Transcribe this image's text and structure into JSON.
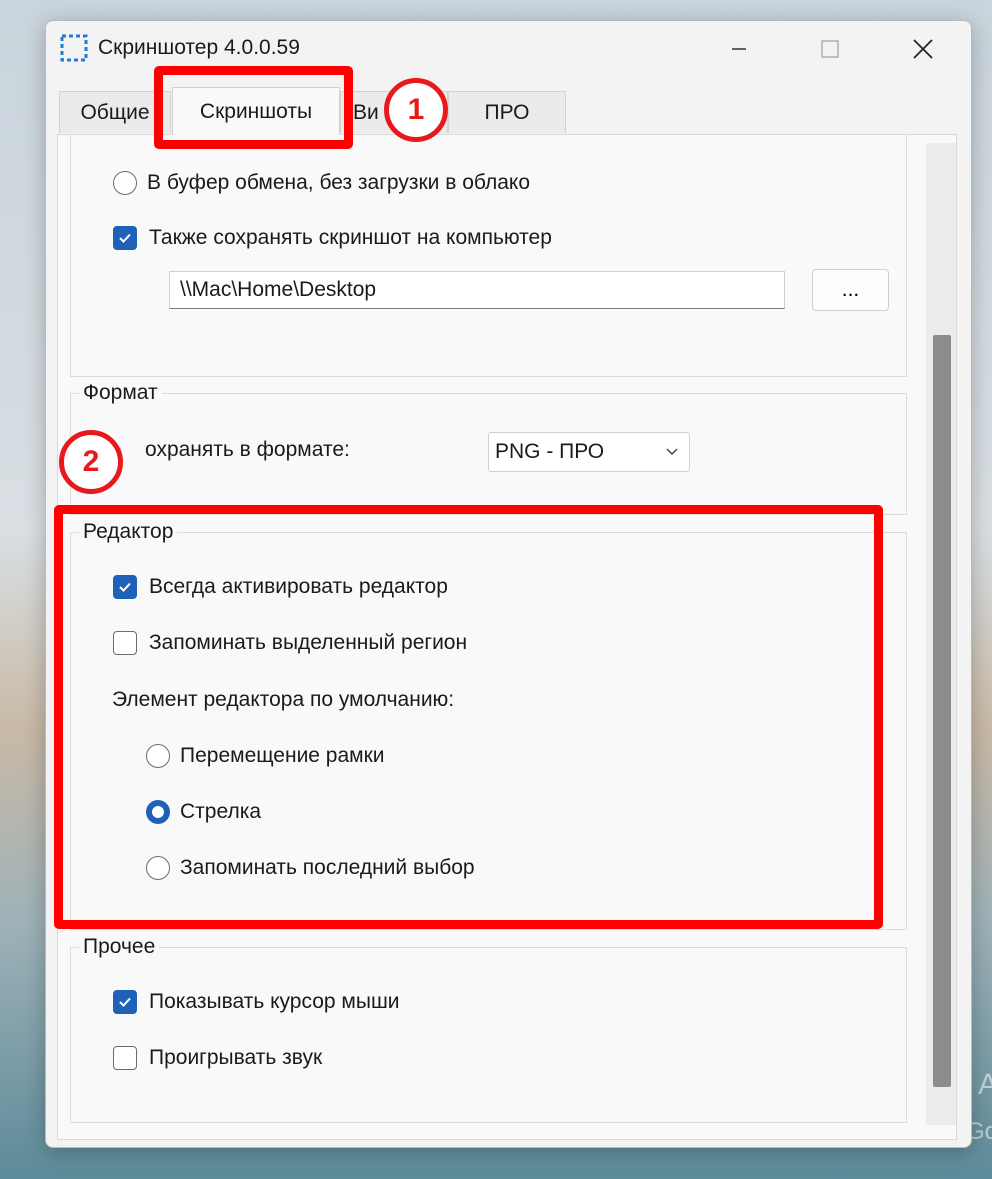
{
  "desktop": {
    "right_top": "A",
    "right_bottom": "Go"
  },
  "window": {
    "title": "Скриншотер 4.0.0.59",
    "icon": "screenshot-selection-icon",
    "controls": [
      "minimize-icon",
      "maximize-icon",
      "close-icon"
    ]
  },
  "tabs": [
    {
      "label": "Общие",
      "active": false
    },
    {
      "label": "Скриншоты",
      "active": true
    },
    {
      "label": "Ви",
      "active": false
    },
    {
      "label": "ПРО",
      "active": false
    }
  ],
  "upload": {
    "clipboard_only_label": "В буфер обмена, без загрузки в облако",
    "clipboard_only_selected": false,
    "save_to_computer_label": "Также сохранять скриншот на компьютер",
    "save_to_computer_checked": true,
    "path_value": "\\\\Mac\\Home\\Desktop",
    "browse_label": "..."
  },
  "format": {
    "group_label": "Формат",
    "save_format_label": "охранять в формате:",
    "format_value": "PNG - ПРО"
  },
  "editor": {
    "group_label": "Редактор",
    "always_activate_label": "Всегда активировать редактор",
    "always_activate_checked": true,
    "remember_region_label": "Запоминать выделенный регион",
    "remember_region_checked": false,
    "default_tool_label": "Элемент редактора по умолчанию:",
    "options": [
      {
        "label": "Перемещение рамки",
        "selected": false
      },
      {
        "label": "Стрелка",
        "selected": true
      },
      {
        "label": "Запоминать последний выбор",
        "selected": false
      }
    ]
  },
  "other": {
    "group_label": "Прочее",
    "show_cursor_label": "Показывать курсор мыши",
    "show_cursor_checked": true,
    "play_sound_label": "Проигрывать звук",
    "play_sound_checked": false
  },
  "annotations": {
    "step1": "1",
    "step2": "2",
    "color": "#ff0000"
  },
  "colors": {
    "accent": "#1f60b8",
    "annotation": "#ff0000"
  }
}
